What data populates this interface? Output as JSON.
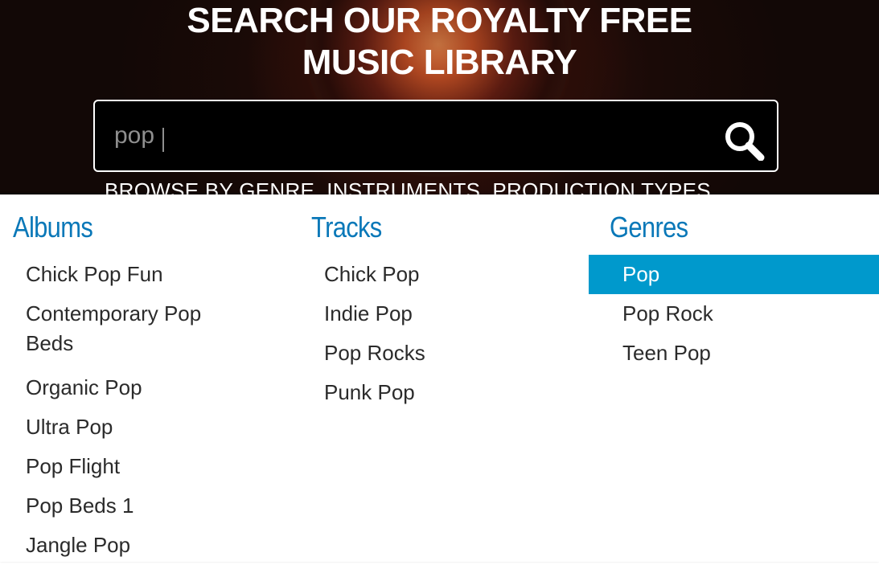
{
  "hero": {
    "title_line1": "SEARCH OUR ROYALTY FREE",
    "title_line2": "MUSIC LIBRARY",
    "browse_text": "BROWSE BY GENRE, INSTRUMENTS, PRODUCTION TYPES"
  },
  "search": {
    "value": "pop",
    "button_icon": "search-icon"
  },
  "results": {
    "albums": {
      "heading": "Albums",
      "items": [
        "Chick Pop Fun",
        "Contemporary Pop Beds",
        "Organic Pop",
        "Ultra Pop",
        "Pop Flight",
        "Pop Beds 1",
        "Jangle Pop"
      ]
    },
    "tracks": {
      "heading": "Tracks",
      "items": [
        "Chick Pop",
        "Indie Pop",
        "Pop Rocks",
        "Punk Pop"
      ]
    },
    "genres": {
      "heading": "Genres",
      "items": [
        "Pop",
        "Pop Rock",
        "Teen Pop"
      ],
      "active_index": 0
    }
  },
  "colors": {
    "heading": "#0a78b8",
    "active_bg": "#0099cc",
    "item_text": "#2b2b2b"
  }
}
